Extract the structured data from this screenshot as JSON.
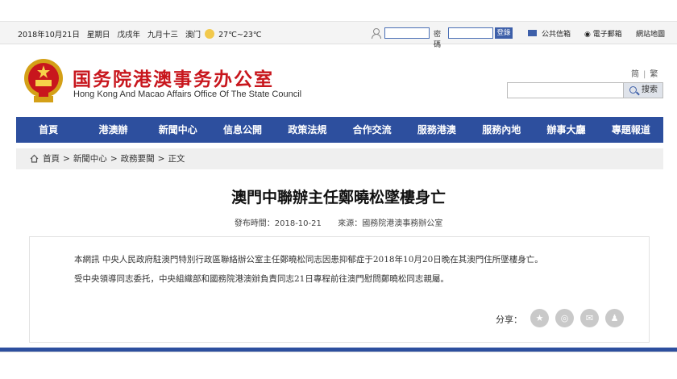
{
  "topbar": {
    "date": "2018年10月21日",
    "weekday": "星期日",
    "lunar_year": "戊戌年",
    "lunar_day": "九月十三",
    "city": "澳门",
    "weather_icon": "sun-icon",
    "temperature": "27℃~23℃",
    "password_label": "密碼",
    "login_button": "登錄",
    "links": [
      "公共信箱",
      "電子郵箱",
      "網站地圖"
    ]
  },
  "header": {
    "title": "国务院港澳事务办公室",
    "subtitle": "Hong Kong And Macao Affairs Office Of The State Council",
    "lang_simplified": "简",
    "lang_separator": "|",
    "lang_traditional": "繁",
    "search_button": "搜索"
  },
  "nav": {
    "items": [
      "首頁",
      "港澳辦",
      "新聞中心",
      "信息公開",
      "政策法規",
      "合作交流",
      "服務港澳",
      "服務內地",
      "辦事大廳",
      "專題報道"
    ]
  },
  "breadcrumb": [
    "首頁",
    "新聞中心",
    "政務要聞",
    "正文"
  ],
  "article": {
    "title": "澳門中聯辦主任鄭曉松墜樓身亡",
    "date_label": "發布時間：",
    "date": "2018-10-21",
    "source_label": "來源：",
    "source": "國務院港澳事務辦公室",
    "paragraphs": [
      "本網訊  中央人民政府駐澳門特別行政區聯絡辦公室主任鄭曉松同志因患抑郁症于2018年10月20日晚在其澳門住所墜樓身亡。",
      "受中央領導同志委托，中央組織部和國務院港澳辦負責同志21日專程前往澳門慰問鄭曉松同志親屬。"
    ],
    "share_label": "分享："
  },
  "colors": {
    "brand_red": "#c8161d",
    "nav_blue": "#2d4f9e"
  }
}
